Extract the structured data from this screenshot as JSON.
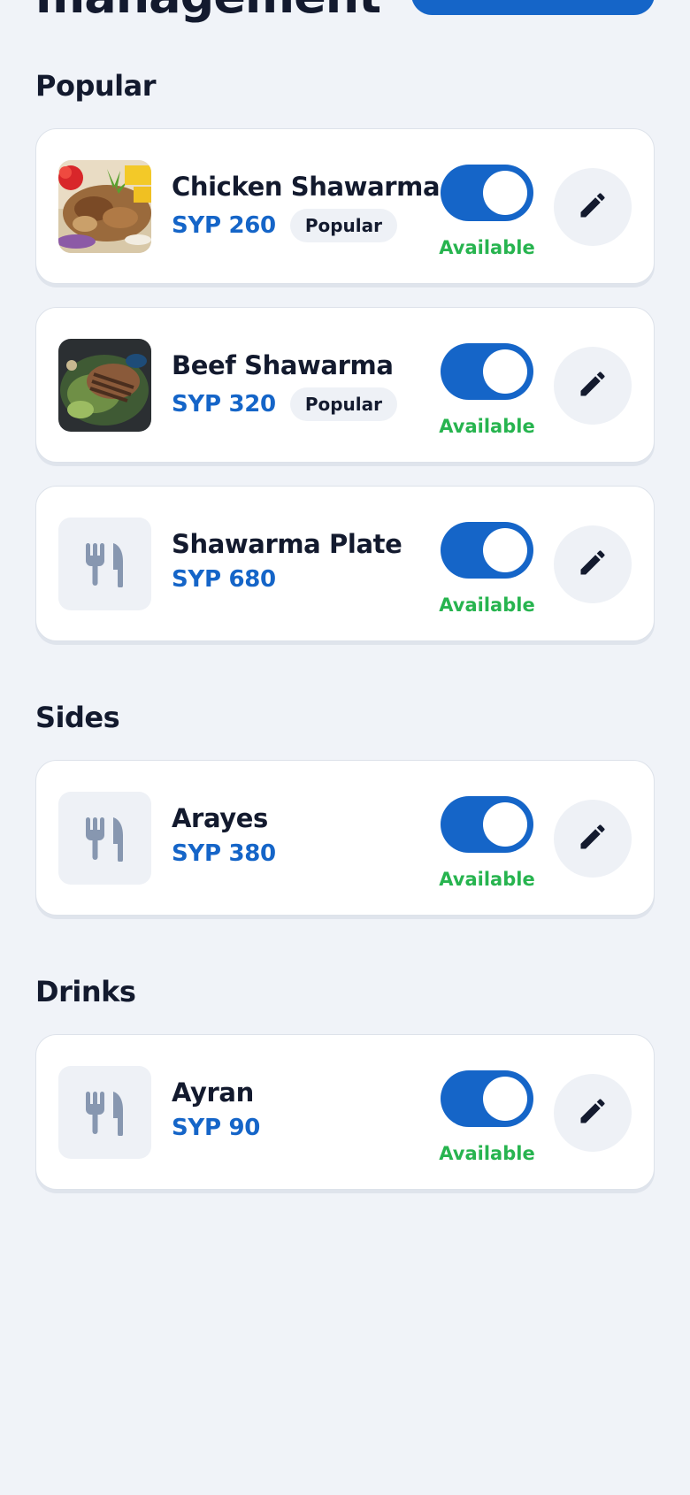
{
  "header": {
    "title": "management"
  },
  "colors": {
    "accent": "#1565c8",
    "available": "#27b44f",
    "background": "#f0f3f8"
  },
  "sections": [
    {
      "title": "Popular",
      "items": [
        {
          "name": "Chicken Shawarma",
          "price": "SYP 260",
          "badge": "Popular",
          "status": "Available",
          "available": true,
          "image": "chicken-shawarma-photo"
        },
        {
          "name": "Beef Shawarma",
          "price": "SYP 320",
          "badge": "Popular",
          "status": "Available",
          "available": true,
          "image": "beef-shawarma-photo"
        },
        {
          "name": "Shawarma Plate",
          "price": "SYP 680",
          "status": "Available",
          "available": true,
          "image": "utensils-icon"
        }
      ]
    },
    {
      "title": "Sides",
      "items": [
        {
          "name": "Arayes",
          "price": "SYP 380",
          "status": "Available",
          "available": true,
          "image": "utensils-icon"
        }
      ]
    },
    {
      "title": "Drinks",
      "items": [
        {
          "name": "Ayran",
          "price": "SYP 90",
          "status": "Available",
          "available": true,
          "image": "utensils-icon"
        }
      ]
    }
  ]
}
